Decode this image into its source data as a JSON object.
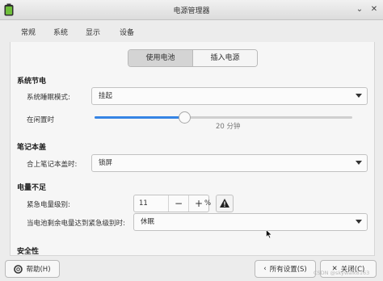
{
  "window": {
    "title": "电源管理器",
    "minimize": "⌄",
    "close": "✕"
  },
  "tabs": [
    {
      "label": "常规",
      "active": false
    },
    {
      "label": "系统",
      "active": true
    },
    {
      "label": "显示",
      "active": false
    },
    {
      "label": "设备",
      "active": false
    }
  ],
  "segment": {
    "battery": "使用电池",
    "plugged": "插入电源"
  },
  "system_sleep": {
    "heading": "系统节电",
    "mode_label": "系统睡眠模式:",
    "mode_value": "挂起",
    "idle_label": "在闲置时",
    "idle_value_text": "20 分钟",
    "idle_fraction": 0.345
  },
  "laptop_lid": {
    "heading": "笔记本盖",
    "lid_label": "合上笔记本盖时:",
    "lid_value": "锁屏"
  },
  "low_power": {
    "heading": "电量不足",
    "critical_label": "紧急电量级别:",
    "critical_value": "11",
    "minus": "−",
    "plus": "+",
    "unit": "%",
    "action_label": "当电池剩余电量达到紧急级别时:",
    "action_value": "休眠"
  },
  "security": {
    "heading": "安全性"
  },
  "footer": {
    "help": "帮助(H)",
    "all_settings": "所有设置(S)",
    "close": "关闭(C)"
  },
  "watermark": "CSDN @skywalk8163",
  "colors": {
    "accent": "#3584e4",
    "icon_green": "#6fbf3a"
  }
}
